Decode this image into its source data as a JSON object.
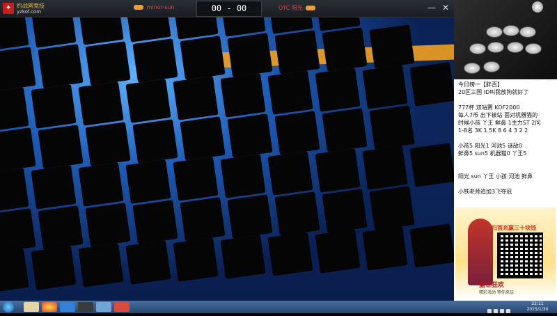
{
  "app": {
    "logo_line1": "约战网竞技",
    "logo_line2": "yzkof.com",
    "player1": "minor-sun",
    "score": "00 - 00",
    "player2": "OTC 阳光",
    "btn_minimize": "—",
    "btn_close": "✕"
  },
  "notes": [
    "今日榜一【胖否】",
    "20区三国 ID叫我放狗就好了",
    "",
    "777杯 双站赛 KOF2000",
    "每人7币 出下被站 面对机器猫的",
    "时候小孩 丫王 鲜鼻 1主力ST 2问",
    "1-8名 3K 1.5K 8 6 4 3 2 2",
    "",
    "小孩5 阳光1 河池5 谜敌0",
    "鲜鼻5 sun5 机器猫0 丫王5",
    "",
    "",
    "阳光  sun 丫王 小孩 河池 鲜鼻",
    "",
    "小铁老师追加3飞夺冠"
  ],
  "ad": {
    "title": "扫首充赢三十块钱",
    "bottom": "盛世狂欢",
    "small": "精彩活动 等你来玩"
  },
  "taskbar": {
    "time": "22:11",
    "date": "2015/1/30"
  },
  "colors": {
    "accent": "#e8a13a",
    "player_text": "#d84b4b",
    "game_blue": "#1d6fcf"
  }
}
